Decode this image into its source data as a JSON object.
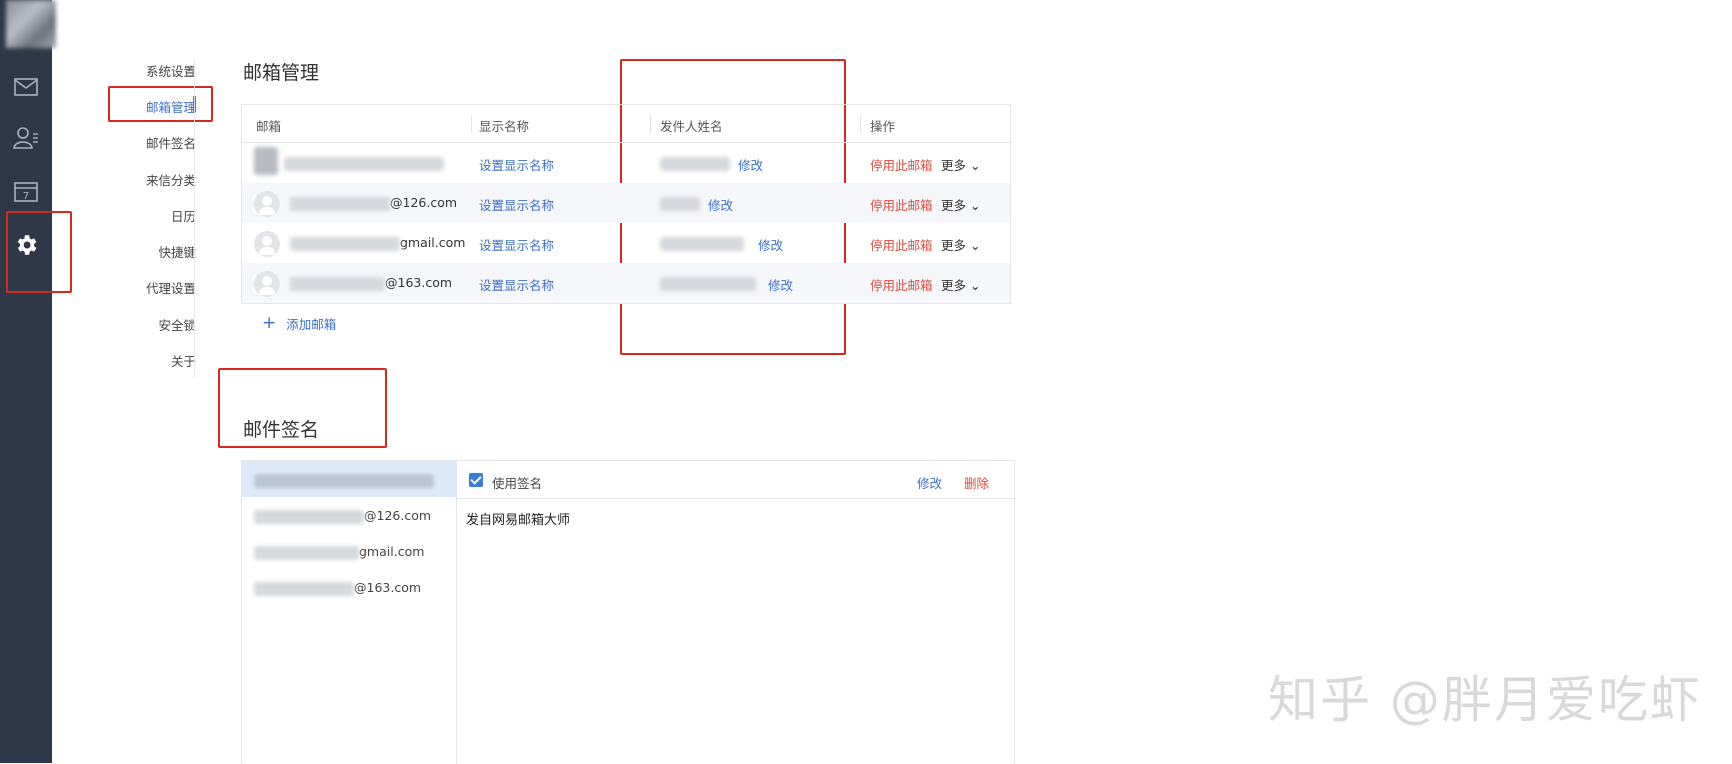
{
  "sidebar_rail": {
    "icons": [
      "mail-icon",
      "contacts-icon",
      "calendar-icon",
      "settings-icon"
    ],
    "calendar_day": "7"
  },
  "settings_menu": {
    "items": [
      {
        "label": "系统设置"
      },
      {
        "label": "邮箱管理"
      },
      {
        "label": "邮件签名"
      },
      {
        "label": "来信分类"
      },
      {
        "label": "日历"
      },
      {
        "label": "快捷键"
      },
      {
        "label": "代理设置"
      },
      {
        "label": "安全锁"
      },
      {
        "label": "关于"
      }
    ],
    "active_index": 1
  },
  "mailbox_section": {
    "title": "邮箱管理",
    "columns": [
      "邮箱",
      "显示名称",
      "发件人姓名",
      "操作"
    ],
    "rows": [
      {
        "email_suffix": "",
        "display_action": "设置显示名称",
        "sender_edit": "修改",
        "disable": "停用此邮箱",
        "more": "更多"
      },
      {
        "email_suffix": "@126.com",
        "display_action": "设置显示名称",
        "sender_edit": "修改",
        "disable": "停用此邮箱",
        "more": "更多"
      },
      {
        "email_suffix": "gmail.com",
        "display_action": "设置显示名称",
        "sender_edit": "修改",
        "disable": "停用此邮箱",
        "more": "更多"
      },
      {
        "email_suffix": "@163.com",
        "display_action": "设置显示名称",
        "sender_edit": "修改",
        "disable": "停用此邮箱",
        "more": "更多"
      }
    ],
    "add_label": "添加邮箱"
  },
  "signature_section": {
    "title": "邮件签名",
    "accounts": [
      {
        "suffix": ""
      },
      {
        "suffix": "@126.com"
      },
      {
        "suffix": "gmail.com"
      },
      {
        "suffix": "@163.com"
      }
    ],
    "use_signature_label": "使用签名",
    "use_signature_checked": true,
    "edit_label": "修改",
    "delete_label": "删除",
    "signature_text": "发自网易邮箱大师"
  },
  "watermark": "知乎 @胖月爱吃虾",
  "colors": {
    "rail_bg": "#2f3848",
    "accent": "#3d6fc7",
    "danger": "#d84a3c",
    "annotation_red": "#d8281e"
  }
}
